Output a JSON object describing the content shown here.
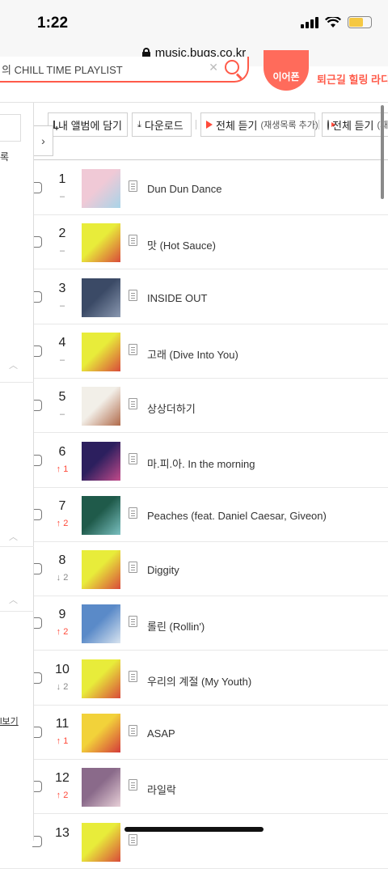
{
  "status": {
    "time": "1:22"
  },
  "browser": {
    "url": "music.bugs.co.kr"
  },
  "search": {
    "query": "의 CHILL TIME PLAYLIST"
  },
  "promo": {
    "badge": "이어폰",
    "text": "퇴근길 힐링 라디"
  },
  "sidebar": {
    "item": "록",
    "link": "l보기"
  },
  "toolbar": {
    "add_album": "내 앨범에 담기",
    "download": "다운로드",
    "play_all_add": "전체 듣기",
    "play_all_add_sub": "(재생목록 추가)",
    "play_all": "전체 듣기",
    "play_all_sub": "(재생"
  },
  "tracks": [
    {
      "rank": "1",
      "change": "–",
      "dir": "same",
      "title": "Dun Dun Dance",
      "art": [
        "#f0c9d6",
        "#a8d4e8"
      ]
    },
    {
      "rank": "2",
      "change": "–",
      "dir": "same",
      "title": "맛 (Hot Sauce)",
      "art": [
        "#e8ec3a",
        "#d94a3a"
      ]
    },
    {
      "rank": "3",
      "change": "–",
      "dir": "same",
      "title": "INSIDE OUT",
      "art": [
        "#3b4a66",
        "#8a98b0"
      ]
    },
    {
      "rank": "4",
      "change": "–",
      "dir": "same",
      "title": "고래 (Dive Into You)",
      "art": [
        "#e8ec3a",
        "#d94a3a"
      ]
    },
    {
      "rank": "5",
      "change": "–",
      "dir": "same",
      "title": "상상더하기",
      "art": [
        "#f2efe8",
        "#b06a4a"
      ]
    },
    {
      "rank": "6",
      "change": "1",
      "dir": "up",
      "title": "마.피.아. In the morning",
      "art": [
        "#2c1f5e",
        "#c24a8a"
      ]
    },
    {
      "rank": "7",
      "change": "2",
      "dir": "up",
      "title": "Peaches (feat. Daniel Caesar, Giveon)",
      "art": [
        "#1f5a4a",
        "#7ac0c0"
      ]
    },
    {
      "rank": "8",
      "change": "2",
      "dir": "down",
      "title": "Diggity",
      "art": [
        "#e8ec3a",
        "#d94a3a"
      ]
    },
    {
      "rank": "9",
      "change": "2",
      "dir": "up",
      "title": "롤린 (Rollin')",
      "art": [
        "#5a8ac8",
        "#d8e4f0"
      ]
    },
    {
      "rank": "10",
      "change": "2",
      "dir": "down",
      "title": "우리의 계절 (My Youth)",
      "art": [
        "#e8ec3a",
        "#d94a3a"
      ]
    },
    {
      "rank": "11",
      "change": "1",
      "dir": "up",
      "title": "ASAP",
      "art": [
        "#f2d23a",
        "#d43a3a"
      ]
    },
    {
      "rank": "12",
      "change": "2",
      "dir": "up",
      "title": "라일락",
      "art": [
        "#8a6a8a",
        "#e8d0d8"
      ]
    },
    {
      "rank": "13",
      "change": "",
      "dir": "same",
      "title": "",
      "art": [
        "#e8ec3a",
        "#d94a3a"
      ]
    }
  ],
  "colors": {
    "accent": "#ff5b4a",
    "up": "#ff4a3a"
  }
}
